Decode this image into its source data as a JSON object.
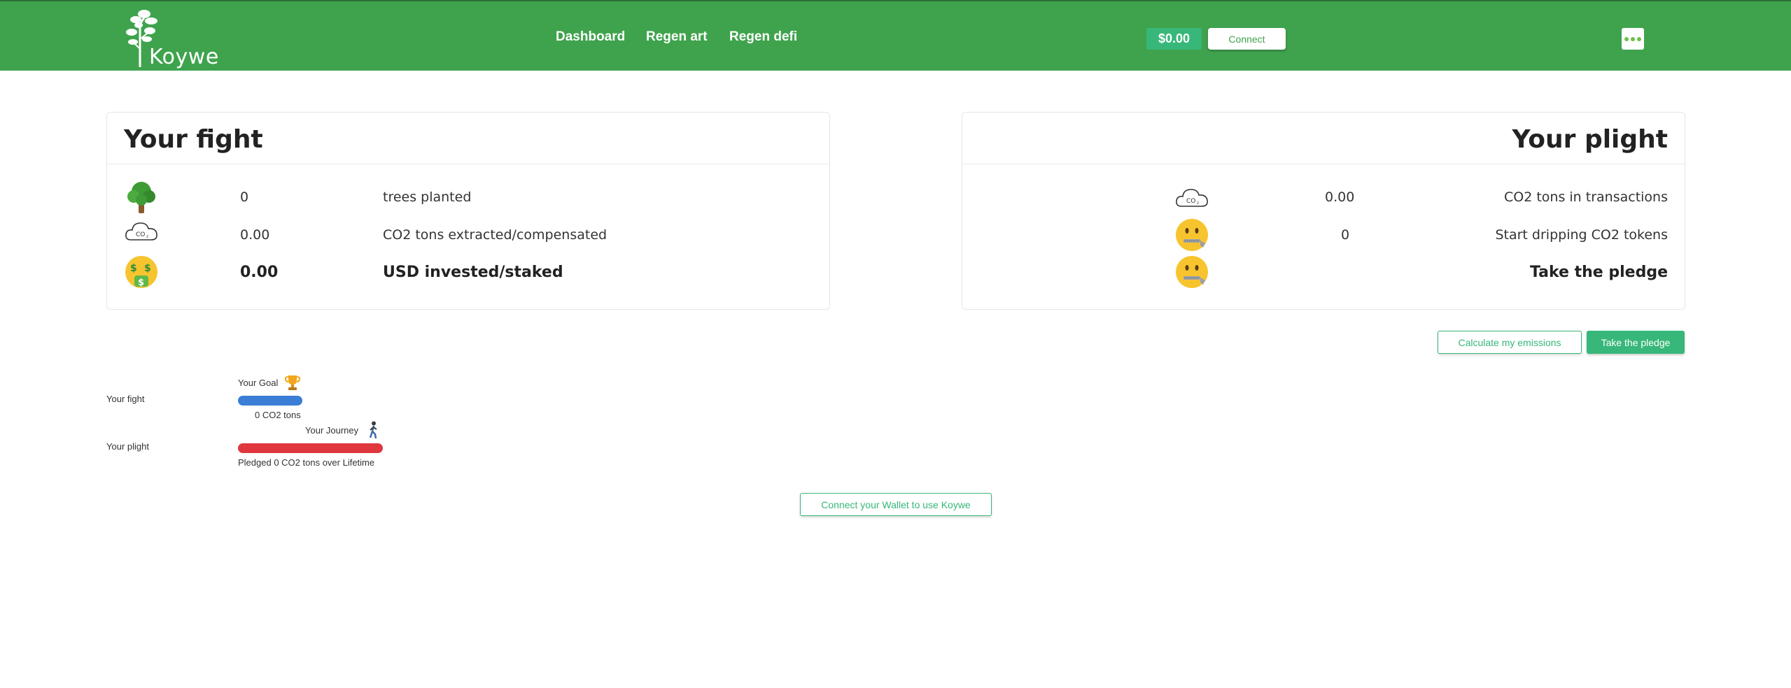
{
  "header": {
    "logo_text": "Koywe",
    "nav": [
      "Dashboard",
      "Regen art",
      "Regen defi"
    ],
    "balance": "$0.00",
    "connect_label": "Connect",
    "colors": {
      "bar": "#3fa34d",
      "accent": "#37b779"
    }
  },
  "fight": {
    "title": "Your fight",
    "rows": [
      {
        "icon": "tree-icon",
        "value": "0",
        "label": "trees planted"
      },
      {
        "icon": "co2-cloud-icon",
        "value": "0.00",
        "label": "CO2 tons extracted/compensated"
      },
      {
        "icon": "money-mouth-face-icon",
        "value": "0.00",
        "label": "USD invested/staked"
      }
    ]
  },
  "plight": {
    "title": "Your plight",
    "rows": [
      {
        "icon": "co2-cloud-icon",
        "value": "0.00",
        "label": "CO2 tons in transactions"
      },
      {
        "icon": "zipper-mouth-face-icon",
        "value": "0",
        "label": "Start dripping CO2 tokens"
      },
      {
        "icon": "zipper-mouth-face-icon",
        "value": "",
        "label": "Take the pledge"
      }
    ]
  },
  "actions": {
    "calculate_label": "Calculate my emissions",
    "pledge_label": "Take the pledge"
  },
  "progress": {
    "fight_label": "Your fight",
    "goal_label": "Your Goal",
    "goal_tons": "0 CO2 tons",
    "plight_label": "Your plight",
    "journey_label": "Your Journey",
    "pledged_text": "Pledged 0 CO2 tons over Lifetime",
    "colors": {
      "fight_bar": "#3a7fd5",
      "plight_bar": "#e0373f"
    }
  },
  "wallet_prompt": "Connect your Wallet to use Koywe"
}
